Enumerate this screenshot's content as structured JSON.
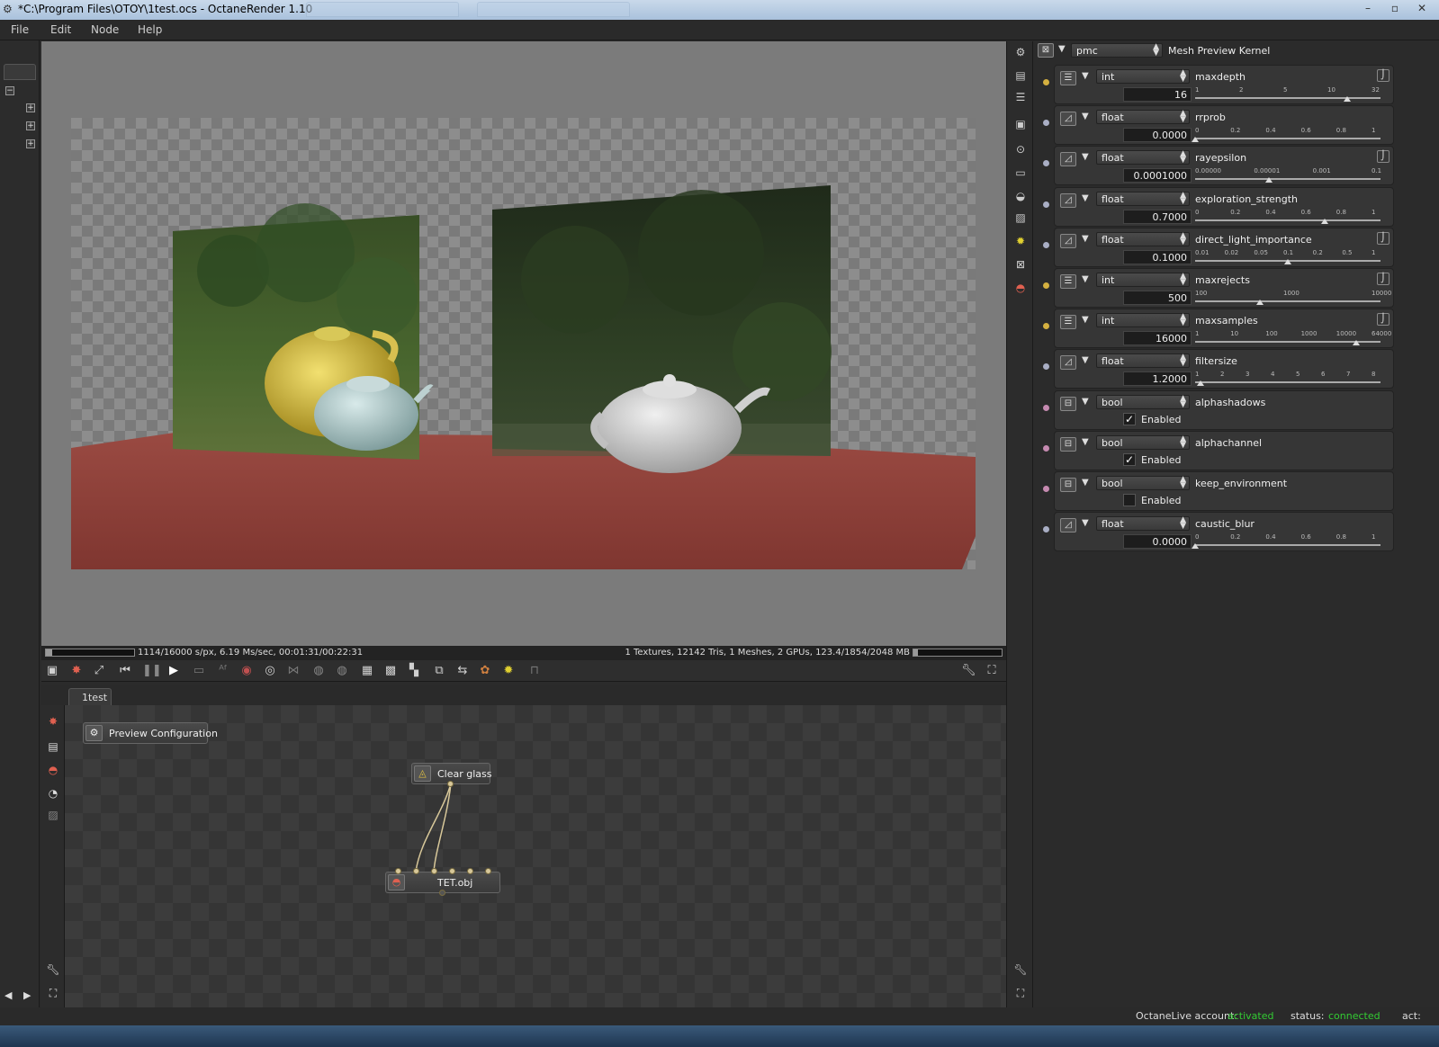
{
  "window": {
    "title": "*C:\\Program Files\\OTOY\\1test.ocs - OctaneRender 1.10",
    "controls": [
      "–",
      "▫",
      "✕"
    ]
  },
  "menu": [
    "File",
    "Edit",
    "Node",
    "Help"
  ],
  "viewport": {
    "status_left": "1114/16000 s/px, 6.19 Ms/sec, 00:01:31/00:22:31",
    "status_right": "1 Textures, 12142 Tris, 1 Meshes, 2 GPUs, 123.4/1854/2048 MB",
    "progress": 0.07,
    "memory_progress": 0.05
  },
  "node_graph": {
    "tab": "1test",
    "nodes": {
      "preview_configuration": "Preview Configuration",
      "clear_glass": "Clear glass",
      "tet_obj": "TET.obj"
    }
  },
  "inspector": {
    "kernel_select": "pmc",
    "kernel_name": "Mesh Preview Kernel",
    "params": [
      {
        "type": "int",
        "name": "maxdepth",
        "value": "16",
        "ticks": [
          "1",
          "2",
          "5",
          "10",
          "32"
        ],
        "pos": 0.82,
        "dot": "#d4b040"
      },
      {
        "type": "float",
        "name": "rrprob",
        "value": "0.0000",
        "ticks": [
          "0",
          "0.2",
          "0.4",
          "0.6",
          "0.8",
          "1"
        ],
        "pos": 0.0,
        "dot": "#a9aec4"
      },
      {
        "type": "float",
        "name": "rayepsilon",
        "value": "0.0001000",
        "ticks": [
          "0.00000",
          "0.00001",
          "0.001",
          "0.1"
        ],
        "pos": 0.4,
        "dot": "#a9aec4"
      },
      {
        "type": "float",
        "name": "exploration_strength",
        "value": "0.7000",
        "ticks": [
          "0",
          "0.2",
          "0.4",
          "0.6",
          "0.8",
          "1"
        ],
        "pos": 0.7,
        "dot": "#a9aec4"
      },
      {
        "type": "float",
        "name": "direct_light_importance",
        "value": "0.1000",
        "ticks": [
          "0.01",
          "0.02",
          "0.05",
          "0.1",
          "0.2",
          "0.5",
          "1"
        ],
        "pos": 0.5,
        "dot": "#a9aec4"
      },
      {
        "type": "int",
        "name": "maxrejects",
        "value": "500",
        "ticks": [
          "100",
          "1000",
          "10000"
        ],
        "pos": 0.35,
        "dot": "#d4b040"
      },
      {
        "type": "int",
        "name": "maxsamples",
        "value": "16000",
        "ticks": [
          "1",
          "10",
          "100",
          "1000",
          "10000",
          "64000"
        ],
        "pos": 0.87,
        "dot": "#d4b040"
      },
      {
        "type": "float",
        "name": "filtersize",
        "value": "1.2000",
        "ticks": [
          "1",
          "2",
          "3",
          "4",
          "5",
          "6",
          "7",
          "8"
        ],
        "pos": 0.03,
        "dot": "#a9aec4"
      },
      {
        "type": "bool",
        "name": "alphashadows",
        "checked": true,
        "label": "Enabled",
        "dot": "#c58ab0"
      },
      {
        "type": "bool",
        "name": "alphachannel",
        "checked": true,
        "label": "Enabled",
        "dot": "#c58ab0"
      },
      {
        "type": "bool",
        "name": "keep_environment",
        "checked": false,
        "label": "Enabled",
        "dot": "#c58ab0"
      },
      {
        "type": "float",
        "name": "caustic_blur",
        "value": "0.0000",
        "ticks": [
          "0",
          "0.2",
          "0.4",
          "0.6",
          "0.8",
          "1"
        ],
        "pos": 0.0,
        "dot": "#a9aec4"
      }
    ]
  },
  "statusbar": {
    "account_label": "OctaneLive account:",
    "account_value": "activated",
    "status_label": "status:",
    "status_value": "connected",
    "act_label": "act:"
  },
  "colors": {
    "accent_green": "#33cc33",
    "table_red": "#8a3e38"
  }
}
